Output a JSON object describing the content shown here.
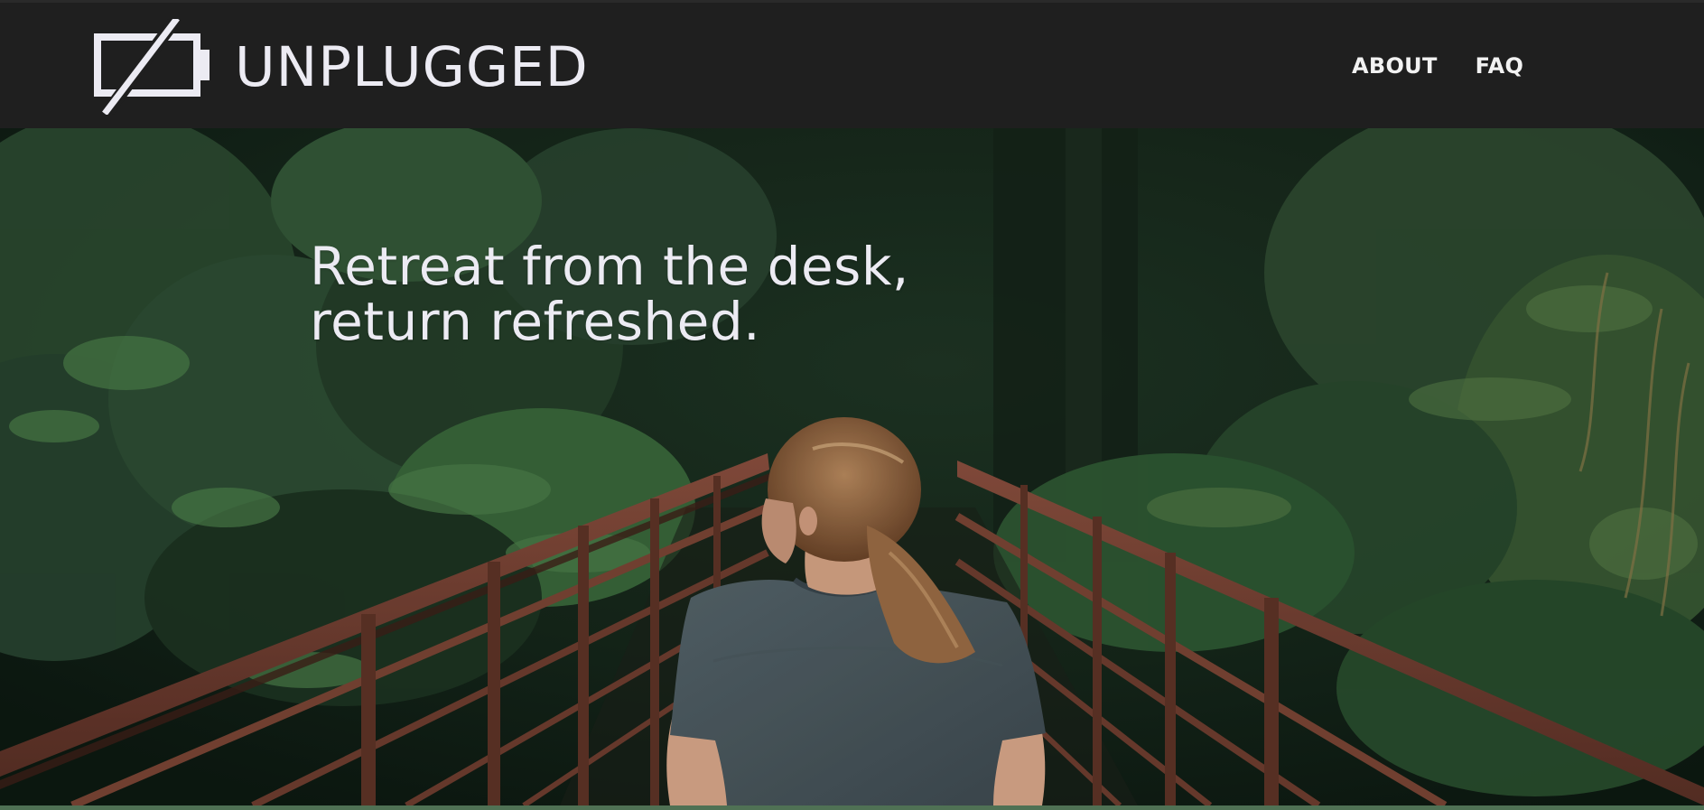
{
  "brand": {
    "name": "UNPLUGGED",
    "logo_icon": "unplugged-battery-icon"
  },
  "nav": {
    "items": [
      {
        "label": "ABOUT"
      },
      {
        "label": "FAQ"
      }
    ]
  },
  "hero": {
    "headline_line1": "Retreat from the desk,",
    "headline_line2": "return refreshed.",
    "image": "woman-on-forest-bridge"
  },
  "colors": {
    "header_bg": "#1f1f1f",
    "text_light": "#ecebf3",
    "forest_green": "#4f7154"
  }
}
